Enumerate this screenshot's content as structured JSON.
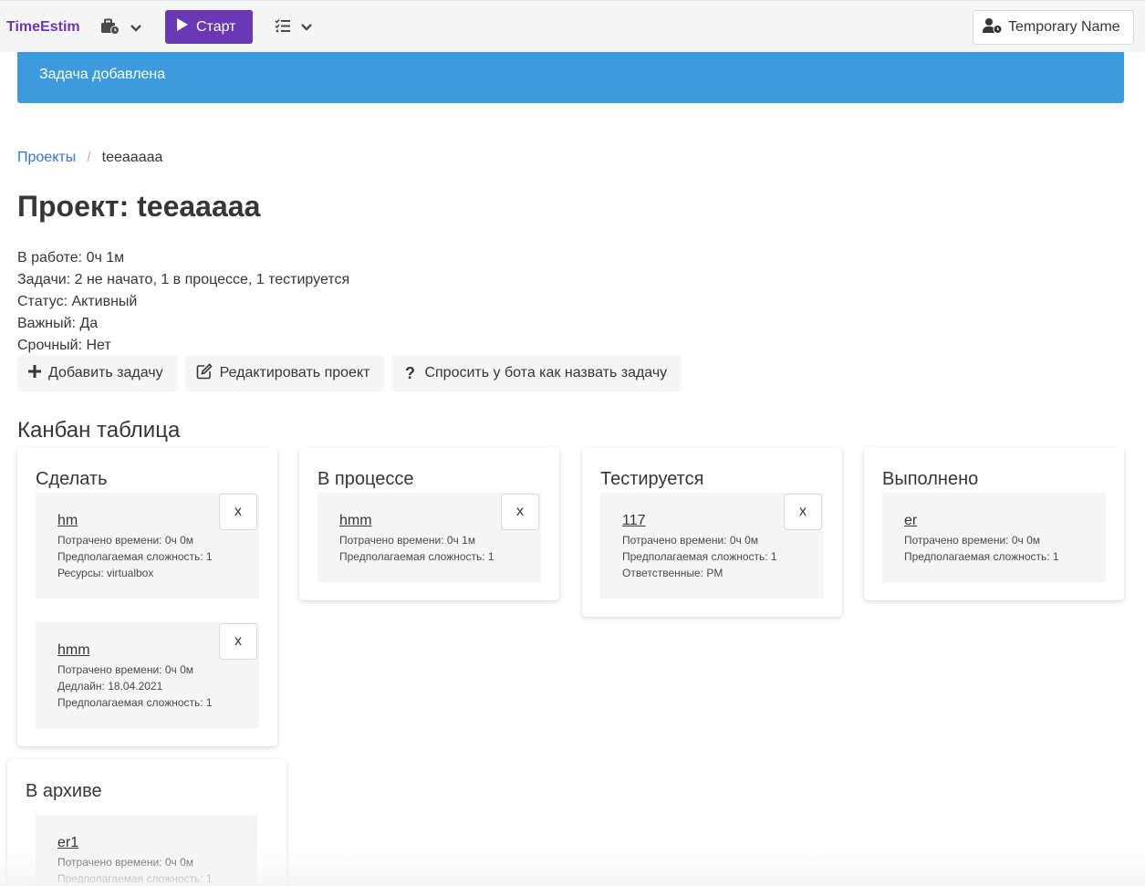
{
  "navbar": {
    "brand": "TimeEstim",
    "start_label": "Старт",
    "user_label": "Temporary Name"
  },
  "notification": {
    "text": "Задача добавлена"
  },
  "breadcrumb": {
    "root": "Проекты",
    "separator": "/",
    "current": "teeaaaaa"
  },
  "project": {
    "title": "Проект: teeaaaaa",
    "info": [
      "В работе: 0ч 1м",
      "Задачи: 2 не начато, 1 в процессе, 1 тестируется",
      "Статус: Активный",
      "Важный: Да",
      "Срочный: Нет"
    ]
  },
  "actions": {
    "add_task": "Добавить задачу",
    "edit_project": "Редактировать проект",
    "ask_bot": "Спросить у бота как назвать задачу"
  },
  "kanban": {
    "title": "Канбан таблица",
    "delete_label": "x",
    "columns": [
      {
        "title": "Сделать",
        "cards": [
          {
            "title": "hm",
            "lines": [
              "Потрачено времени: 0ч 0м",
              "Предполагаемая сложность: 1",
              "Ресурсы: virtualbox"
            ]
          },
          {
            "title": "hmm",
            "lines": [
              "Потрачено времени: 0ч 0м",
              "Дедлайн: 18.04.2021",
              "Предполагаемая сложность: 1"
            ]
          }
        ]
      },
      {
        "title": "В процессе",
        "cards": [
          {
            "title": "hmm",
            "lines": [
              "Потрачено времени: 0ч 1м",
              "Предполагаемая сложность: 1"
            ]
          }
        ]
      },
      {
        "title": "Тестируется",
        "cards": [
          {
            "title": "117",
            "lines": [
              "Потрачено времени: 0ч 0м",
              "Предполагаемая сложность: 1",
              "Ответственные: PM"
            ]
          }
        ]
      },
      {
        "title": "Выполнено",
        "cards": [
          {
            "title": "er",
            "lines": [
              "Потрачено времени: 0ч 0м",
              "Предполагаемая сложность: 1"
            ]
          }
        ]
      },
      {
        "title": "В архиве",
        "cards": [
          {
            "title": "er1",
            "lines": [
              "Потрачено времени: 0ч 0м",
              "Предполагаемая сложность: 1"
            ]
          }
        ]
      }
    ]
  }
}
